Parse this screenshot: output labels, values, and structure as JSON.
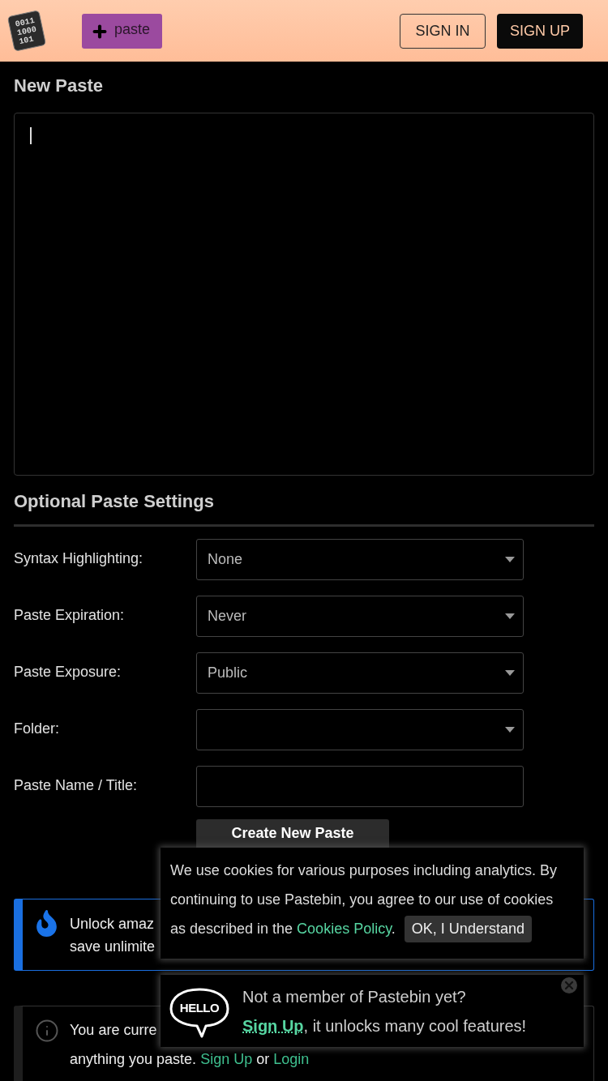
{
  "header": {
    "logo_lines": [
      "0011",
      "1000",
      "101"
    ],
    "new_paste_button": "paste",
    "sign_in_button": "SIGN IN",
    "sign_up_button": "SIGN UP"
  },
  "editor": {
    "title": "New Paste",
    "focused": true
  },
  "settings": {
    "title": "Optional Paste Settings",
    "rows": [
      {
        "label": "Syntax Highlighting:",
        "kind": "select",
        "value": "None"
      },
      {
        "label": "Paste Expiration:",
        "kind": "select",
        "value": "Never"
      },
      {
        "label": "Paste Exposure:",
        "kind": "select",
        "value": "Public"
      },
      {
        "label": "Folder:",
        "kind": "select"
      },
      {
        "label": "Paste Name / Title:",
        "kind": "input"
      }
    ]
  },
  "submit_button": "Create New Paste",
  "upgrade_notice": {
    "lines": [
      "Unlock amaz",
      "save unlimite"
    ]
  },
  "guest_notice": {
    "line_1": "You are curre",
    "line_2": {
      "text": "anything you paste.",
      "link_1": "Sign Up",
      "joiner": "or",
      "link_2": "Login"
    }
  },
  "cookie_banner": {
    "text": "We use cookies for various purposes including analytics. By continuing to use Pastebin, you agree to our use of cookies as described in the",
    "link": "Cookies Policy",
    "after_link": ".",
    "button": "OK, I Understand"
  },
  "signup_popup": {
    "badge": "HELLO",
    "title": "Not a member of Pastebin yet?",
    "link": "Sign Up",
    "text": ", it unlocks many cool features!"
  }
}
